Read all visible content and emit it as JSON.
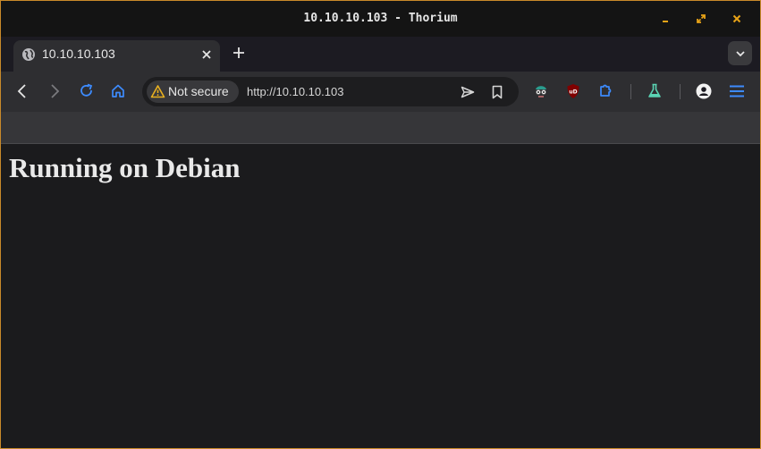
{
  "window": {
    "title": "10.10.10.103 - Thorium",
    "controls": [
      "minimize-icon",
      "maximize-icon",
      "close-icon"
    ],
    "accent_color": "#e8a317"
  },
  "tabs": [
    {
      "title": "10.10.10.103",
      "active": true,
      "favicon": "globe-icon"
    }
  ],
  "toolbar": {
    "security_chip_label": "Not secure",
    "security_icon": "warning-triangle-icon",
    "url": "http://10.10.10.103",
    "accent_color": "#3d8bfd"
  },
  "page": {
    "heading": "Running on Debian",
    "background": "#1b1b1d"
  }
}
